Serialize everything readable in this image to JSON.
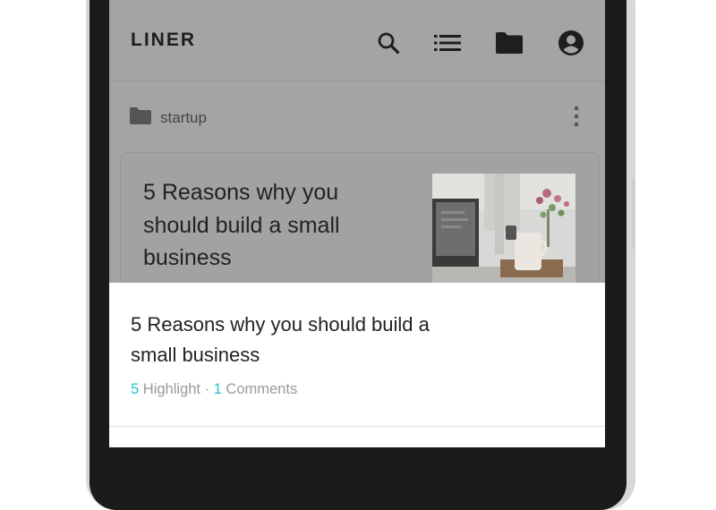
{
  "app": {
    "logo": "LINER"
  },
  "app_bar": {
    "icons": [
      "search-icon",
      "list-icon",
      "folder-icon",
      "account-icon"
    ]
  },
  "folder": {
    "name": "startup"
  },
  "card": {
    "title": "5 Reasons why you should build a small business"
  },
  "sheet": {
    "title": "5 Reasons why you should build a small business",
    "highlight_count": "5",
    "highlight_label": " Highlight",
    "separator": " · ",
    "comment_count": "1",
    "comment_label": " Comments"
  },
  "colors": {
    "accent": "#20c3cf",
    "overlay": "#a4a4a4",
    "frame": "#1b1b1b"
  }
}
